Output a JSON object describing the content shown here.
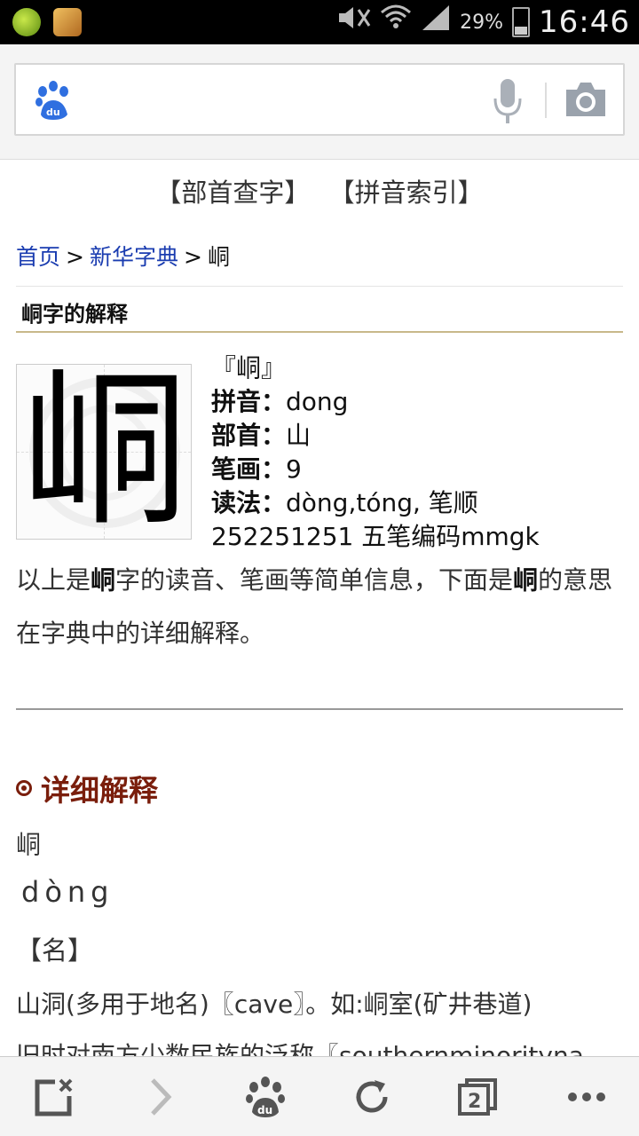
{
  "status_bar": {
    "battery": "29%",
    "battery_level": 0.29,
    "time": "16:46"
  },
  "search": {
    "logo": "baidu-paw-icon",
    "mic_icon": "microphone-icon",
    "camera_icon": "camera-icon"
  },
  "toplinks": [
    "【部首查字】",
    "【拼音索引】"
  ],
  "breadcrumb": {
    "home": "首页",
    "sep1": ">",
    "dict": "新华字典",
    "sep2": ">",
    "current": "峒"
  },
  "section_title": "峒字的解释",
  "char": {
    "glyph": "峒",
    "bracket": "『峒』",
    "pinyin_label": "拼音：",
    "pinyin": "dong",
    "radical_label": "部首：",
    "radical": "山",
    "strokes_label": "笔画：",
    "strokes": "9",
    "reading_label": "读法：",
    "reading": "dòng,tóng, 笔顺",
    "codes": "252251251 五笔编码mmgk"
  },
  "summary": {
    "p1": "以上是",
    "c1": "峒",
    "p2": "字的读音、笔画等简单信息，下面是",
    "c2": "峒",
    "p3": "的意思在字典中的详细解释。"
  },
  "detail": {
    "title": "详细解释",
    "char": "峒",
    "pinyin": "dòng",
    "pos": "【名】",
    "def1": "山洞(多用于地名)〖cave〗。如:峒室(矿井巷道)",
    "def2": "旧时对南方少数民族的泛称〖southernminorityna"
  },
  "bottom_nav": [
    "close-tab-icon",
    "forward-icon",
    "baidu-home-icon",
    "refresh-icon",
    "tabs-count-icon",
    "more-icon"
  ],
  "tab_count": "2"
}
